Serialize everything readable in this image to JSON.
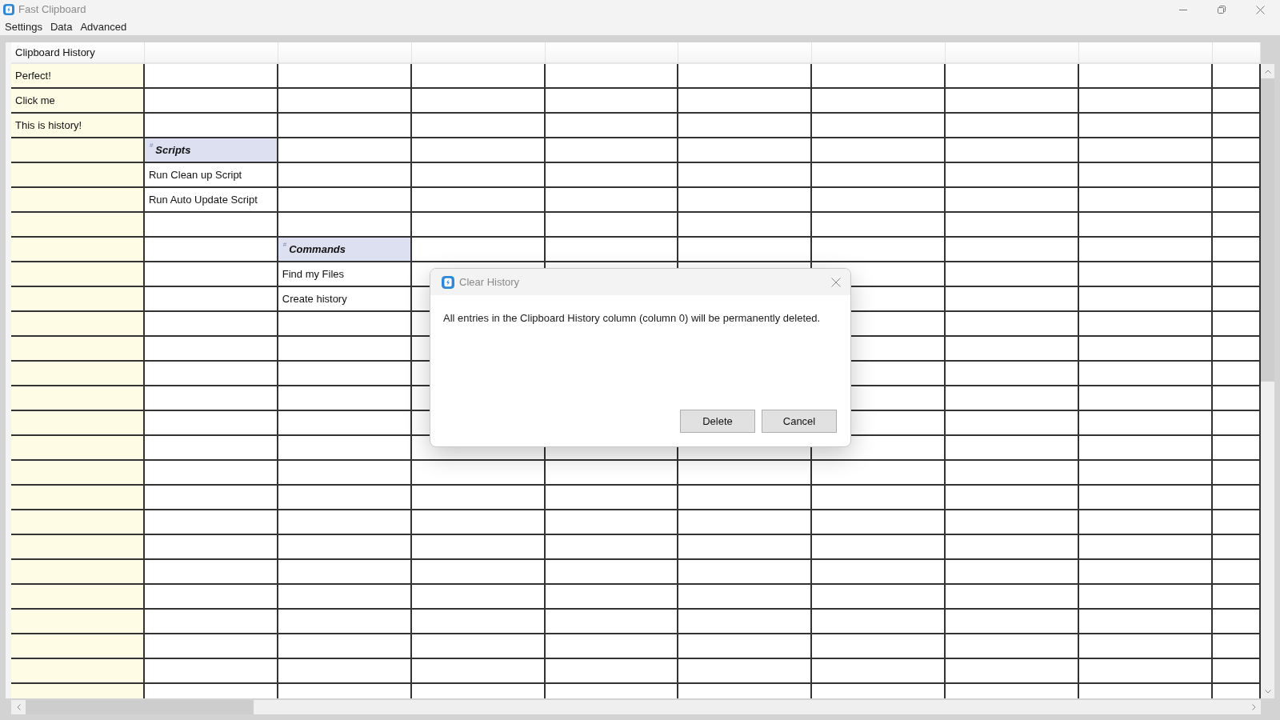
{
  "window": {
    "title": "Fast Clipboard"
  },
  "menu": [
    {
      "label": "Settings"
    },
    {
      "label": "Data"
    },
    {
      "label": "Advanced"
    }
  ],
  "grid": {
    "columns": [
      {
        "kind": "history",
        "header": "Clipboard History"
      },
      {
        "kind": "plain"
      },
      {
        "kind": "plain"
      },
      {
        "kind": "plain"
      },
      {
        "kind": "plain"
      },
      {
        "kind": "plain"
      },
      {
        "kind": "plain"
      },
      {
        "kind": "plain"
      },
      {
        "kind": "plain"
      },
      {
        "kind": "plain"
      }
    ],
    "rows": [
      {
        "cells": [
          {
            "kind": "text",
            "text": "Perfect!"
          }
        ]
      },
      {
        "cells": [
          {
            "kind": "text",
            "text": "Click me"
          }
        ]
      },
      {
        "cells": [
          {
            "kind": "text",
            "text": "This is history!"
          }
        ]
      },
      {
        "cells": [
          {
            "kind": "empty"
          },
          {
            "kind": "group",
            "marker": "#",
            "text": "Scripts"
          }
        ]
      },
      {
        "cells": [
          {
            "kind": "empty"
          },
          {
            "kind": "text",
            "text": "Run Clean up Script"
          }
        ]
      },
      {
        "cells": [
          {
            "kind": "empty"
          },
          {
            "kind": "text",
            "text": "Run Auto Update Script"
          }
        ]
      },
      {
        "cells": [
          {
            "kind": "empty"
          }
        ]
      },
      {
        "cells": [
          {
            "kind": "empty"
          },
          {
            "kind": "empty"
          },
          {
            "kind": "group",
            "marker": "#",
            "text": "Commands"
          }
        ]
      },
      {
        "cells": [
          {
            "kind": "empty"
          },
          {
            "kind": "empty"
          },
          {
            "kind": "text",
            "text": "Find my Files"
          }
        ]
      },
      {
        "cells": [
          {
            "kind": "empty"
          },
          {
            "kind": "empty"
          },
          {
            "kind": "text",
            "text": "Create history"
          }
        ]
      }
    ]
  },
  "dialog": {
    "title": "Clear History",
    "message": "All entries in the Clipboard History column (column 0) will be permanently deleted.",
    "buttons": [
      {
        "label": "Delete"
      },
      {
        "label": "Cancel"
      }
    ]
  }
}
